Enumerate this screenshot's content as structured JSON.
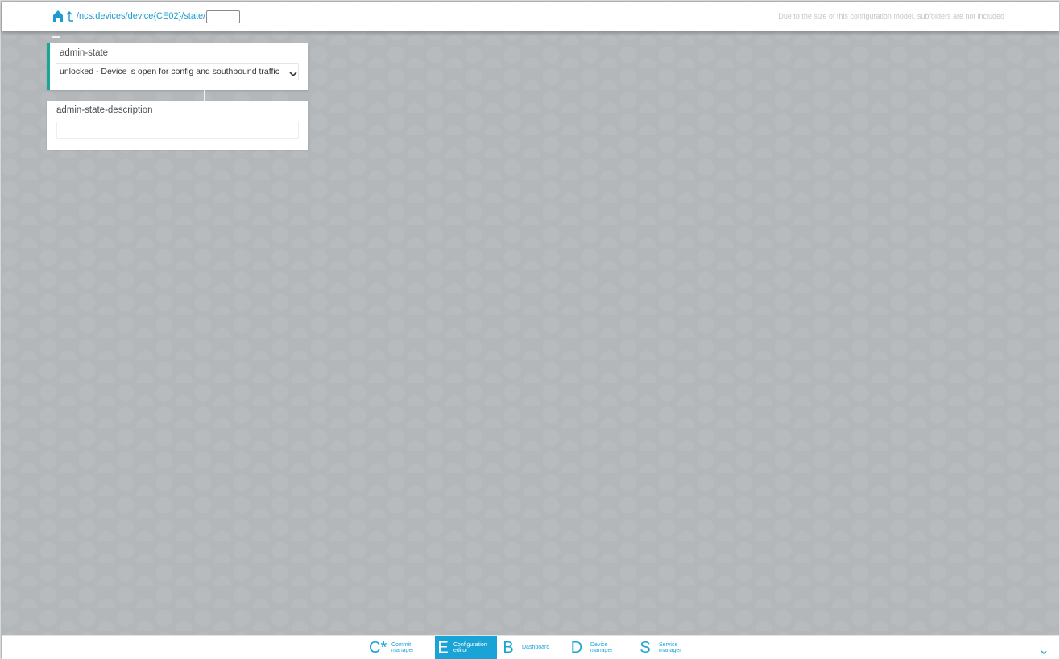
{
  "header": {
    "home_icon": "home-icon",
    "up_icon": "parent-folder-icon",
    "path": "/ncs:devices/device{CE02}/state/",
    "path_input_value": "",
    "note": "Due to the size of this configuration model, subfolders are not included"
  },
  "fields": [
    {
      "label": "admin-state",
      "value": "unlocked - Device is open for config and southbound traffic",
      "accent": "#1aa59a"
    },
    {
      "label": "admin-state-description",
      "value": ""
    }
  ],
  "nav": {
    "items": [
      {
        "letter": "C*",
        "label": "Commit manager",
        "active": false
      },
      {
        "letter": "E",
        "label": "Configuration editor",
        "active": true
      },
      {
        "letter": "B",
        "label": "Dashboard",
        "active": false
      },
      {
        "letter": "D",
        "label": "Device manager",
        "active": false
      },
      {
        "letter": "S",
        "label": "Service manager",
        "active": false
      }
    ],
    "accent": "#1aa3d6"
  }
}
